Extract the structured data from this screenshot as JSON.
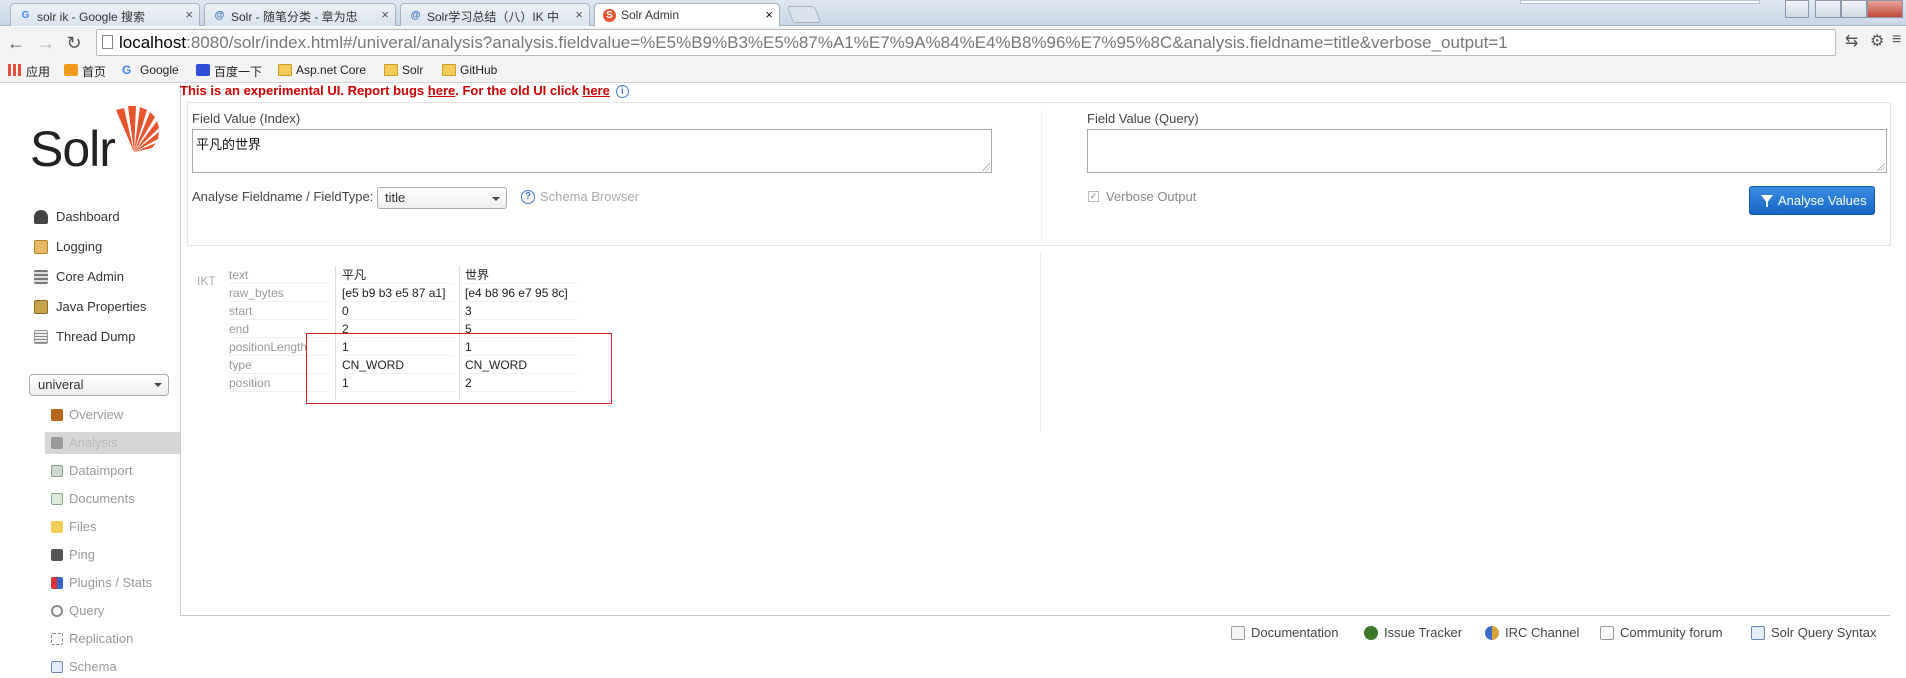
{
  "browser": {
    "tabs": [
      {
        "label": "solr ik - Google 搜索",
        "favicon": "G"
      },
      {
        "label": "Solr - 随笔分类 - 章为忠",
        "favicon": "@"
      },
      {
        "label": "Solr学习总结（八）IK 中",
        "favicon": "@"
      },
      {
        "label": "Solr Admin",
        "favicon": "S"
      }
    ],
    "close_glyph": "×",
    "url_host": "localhost",
    "url_rest": ":8080/solr/index.html#/univeral/analysis?analysis.fieldvalue=%E5%B9%B3%E5%87%A1%E7%9A%84%E4%B8%96%E7%95%8C&analysis.fieldname=title&verbose_output=1",
    "bookmarks": [
      "应用",
      "首页",
      "Google",
      "百度一下",
      "Asp.net Core",
      "Solr",
      "GitHub"
    ]
  },
  "logo_text": "Solr",
  "nav": [
    "Dashboard",
    "Logging",
    "Core Admin",
    "Java Properties",
    "Thread Dump"
  ],
  "core_selector": "univeral",
  "core_menu": [
    "Overview",
    "Analysis",
    "Dataimport",
    "Documents",
    "Files",
    "Ping",
    "Plugins / Stats",
    "Query",
    "Replication",
    "Schema"
  ],
  "banner": {
    "prefix": "This is an experimental UI. Report bugs ",
    "link1": "here",
    "middle": ". For the old UI click ",
    "link2": "here",
    "info": "i"
  },
  "form": {
    "index_label": "Field Value (Index)",
    "index_value": "平凡的世界",
    "query_label": "Field Value (Query)",
    "query_value": "",
    "fieldname_label": "Analyse Fieldname / FieldType:",
    "fieldname_value": "title",
    "schema_browser": "Schema Browser",
    "verbose_label": "Verbose Output",
    "verbose_checked": "✓",
    "analyse_button": "Analyse Values"
  },
  "result": {
    "tokenizer": "IKT",
    "attributes": [
      "text",
      "raw_bytes",
      "start",
      "end",
      "positionLength",
      "type",
      "position"
    ],
    "tokens": [
      {
        "text": "平凡",
        "raw_bytes": "[e5 b9 b3 e5 87 a1]",
        "start": "0",
        "end": "2",
        "positionLength": "1",
        "type": "CN_WORD",
        "position": "1"
      },
      {
        "text": "世界",
        "raw_bytes": "[e4 b8 96 e7 95 8c]",
        "start": "3",
        "end": "5",
        "positionLength": "1",
        "type": "CN_WORD",
        "position": "2"
      }
    ]
  },
  "footer": [
    "Documentation",
    "Issue Tracker",
    "IRC Channel",
    "Community forum",
    "Solr Query Syntax"
  ],
  "colors": {
    "accent_button": "#1766c8",
    "banner_text": "#cc0000",
    "highlight_box": "#e02020"
  }
}
